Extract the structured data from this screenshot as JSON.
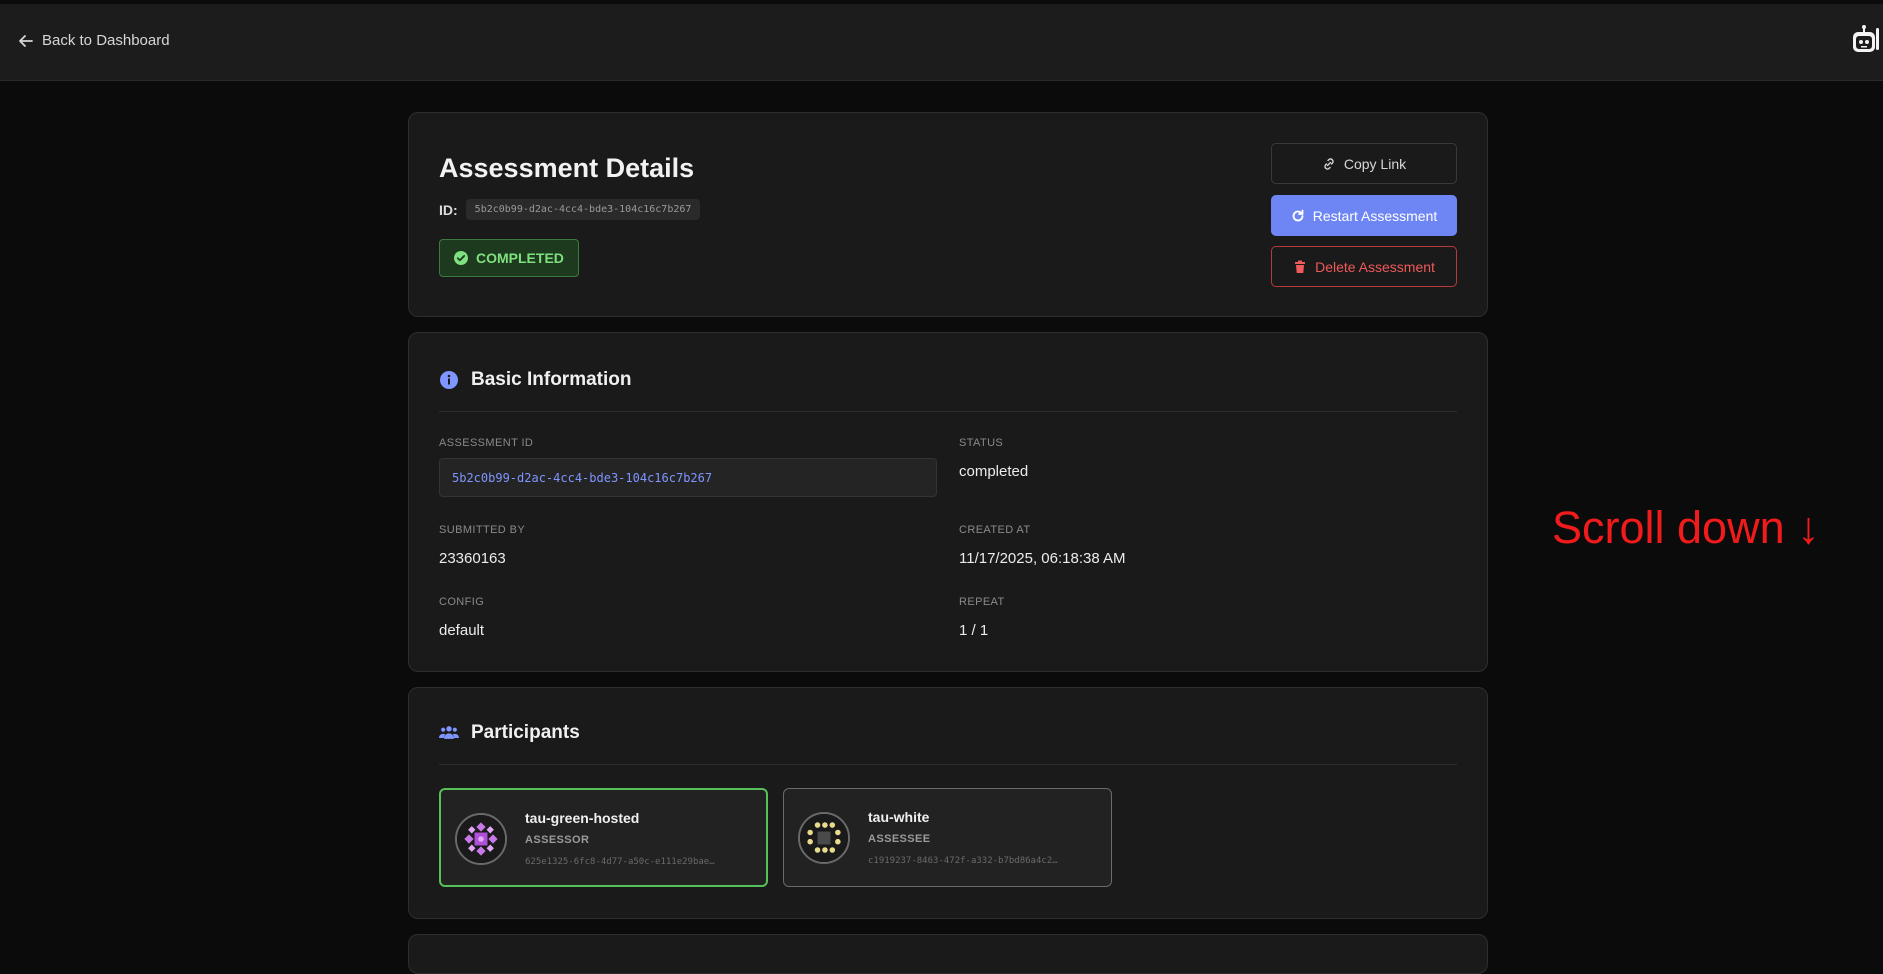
{
  "topbar": {
    "back_label": "Back to Dashboard"
  },
  "header_card": {
    "title": "Assessment Details",
    "id_label": "ID:",
    "id_value": "5b2c0b99-d2ac-4cc4-bde3-104c16c7b267",
    "status_badge": "COMPLETED",
    "copy_label": "Copy Link",
    "restart_label": "Restart Assessment",
    "delete_label": "Delete Assessment"
  },
  "basic_info": {
    "heading": "Basic Information",
    "assessment_id_label": "ASSESSMENT ID",
    "assessment_id_value": "5b2c0b99-d2ac-4cc4-bde3-104c16c7b267",
    "status_label": "STATUS",
    "status_value": "completed",
    "submitted_by_label": "SUBMITTED BY",
    "submitted_by_value": "23360163",
    "created_at_label": "CREATED AT",
    "created_at_value": "11/17/2025, 06:18:38 AM",
    "config_label": "CONFIG",
    "config_value": "default",
    "repeat_label": "REPEAT",
    "repeat_value": "1 / 1"
  },
  "participants": {
    "heading": "Participants",
    "items": [
      {
        "name": "tau-green-hosted",
        "role": "ASSESSOR",
        "id": "625e1325-6fc8-4d77-a50c-e111e29bae…"
      },
      {
        "name": "tau-white",
        "role": "ASSESSEE",
        "id": "c1919237-8463-472f-a332-b7bd86a4c2…"
      }
    ]
  },
  "overlay": {
    "scroll_hint": "Scroll down ↓"
  },
  "colors": {
    "accent": "#6e86f4",
    "success": "#58c058",
    "danger": "#ef5a5a",
    "hint": "#f21b1b"
  },
  "icons": [
    "arrow-left-icon",
    "robot-icon",
    "link-icon",
    "restart-icon",
    "trash-icon",
    "check-circle-icon",
    "info-icon",
    "users-icon"
  ]
}
